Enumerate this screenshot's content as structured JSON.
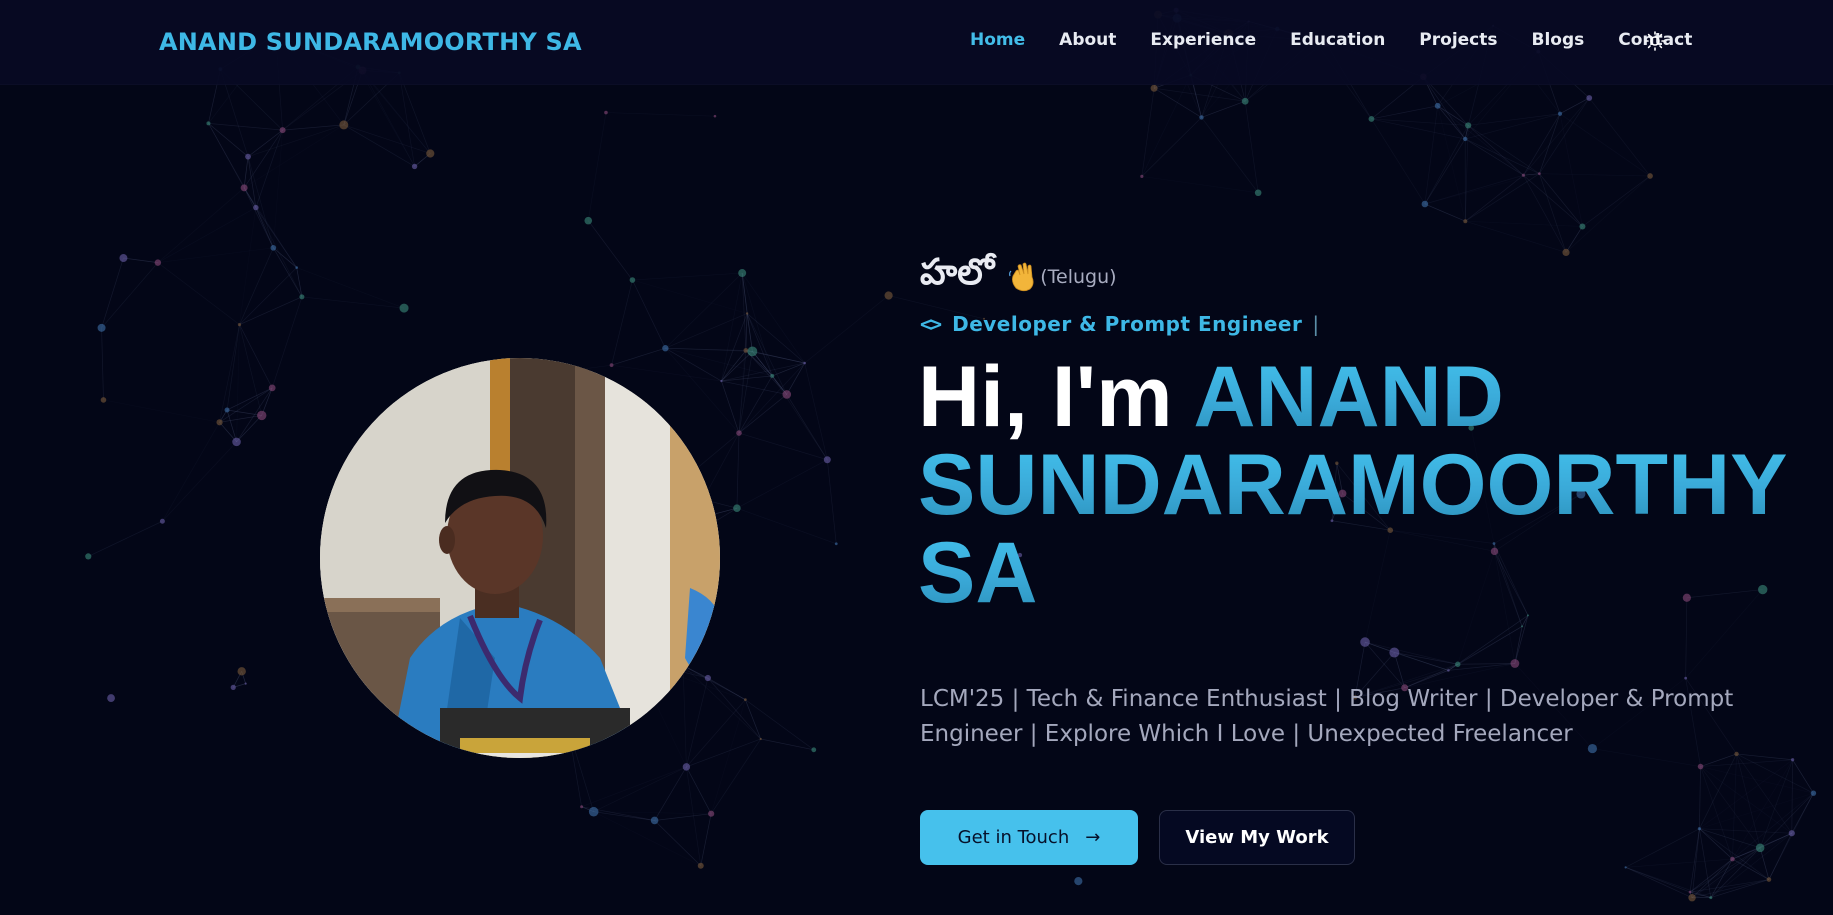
{
  "header": {
    "brand": "ANAND SUNDARAMOORTHY SA",
    "nav": [
      {
        "label": "Home",
        "active": true
      },
      {
        "label": "About",
        "active": false
      },
      {
        "label": "Experience",
        "active": false
      },
      {
        "label": "Education",
        "active": false
      },
      {
        "label": "Projects",
        "active": false
      },
      {
        "label": "Blogs",
        "active": false
      },
      {
        "label": "Contact",
        "active": false
      }
    ],
    "theme_icon": "sun-icon"
  },
  "hero": {
    "greeting": "హలో",
    "greeting_icon": "waving-hand-icon",
    "greeting_language": "(Telugu)",
    "role_icon": "code-brackets-icon",
    "role": "Developer & Prompt Engineer",
    "cursor": "|",
    "title_prefix": "Hi, I'm",
    "title_name": "ANAND SUNDARAMOORTHY SA",
    "tagline": "LCM'25 | Tech & Finance Enthusiast | Blog Writer | Developer & Prompt Engineer | Explore Which I Love | Unexpected Freelancer",
    "primary_button": "Get in Touch",
    "primary_button_icon": "arrow-right-icon",
    "secondary_button": "View My Work"
  },
  "colors": {
    "background": "#030617",
    "accent": "#43bde9",
    "text": "#ffffff",
    "muted": "#a4a8bd"
  }
}
